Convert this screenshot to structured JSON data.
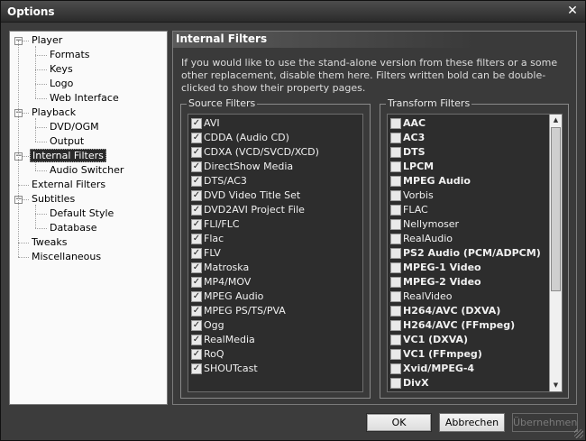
{
  "window": {
    "title": "Options",
    "close_glyph": "✕"
  },
  "tree": {
    "items": [
      {
        "label": "Player",
        "expander": "−"
      },
      {
        "label": "Formats"
      },
      {
        "label": "Keys"
      },
      {
        "label": "Logo"
      },
      {
        "label": "Web Interface"
      },
      {
        "label": "Playback",
        "expander": "−"
      },
      {
        "label": "DVD/OGM"
      },
      {
        "label": "Output"
      },
      {
        "label": "Internal Filters",
        "expander": "−",
        "selected": true
      },
      {
        "label": "Audio Switcher"
      },
      {
        "label": "External Filters"
      },
      {
        "label": "Subtitles",
        "expander": "−"
      },
      {
        "label": "Default Style"
      },
      {
        "label": "Database"
      },
      {
        "label": "Tweaks"
      },
      {
        "label": "Miscellaneous"
      }
    ]
  },
  "panel": {
    "header": "Internal Filters",
    "description": "If you would like to use the stand-alone version from these filters or a some other replacement, disable them here. Filters written bold can be double-clicked to show their property pages."
  },
  "source_filters": {
    "title": "Source Filters",
    "check_glyph": "✓",
    "items": [
      "AVI",
      "CDDA (Audio CD)",
      "CDXA (VCD/SVCD/XCD)",
      "DirectShow Media",
      "DTS/AC3",
      "DVD Video Title Set",
      "DVD2AVI Project File",
      "FLI/FLC",
      "Flac",
      "FLV",
      "Matroska",
      "MP4/MOV",
      "MPEG Audio",
      "MPEG PS/TS/PVA",
      "Ogg",
      "RealMedia",
      "RoQ",
      "SHOUTcast"
    ]
  },
  "transform_filters": {
    "title": "Transform Filters",
    "items": [
      {
        "label": "AAC",
        "bold": true
      },
      {
        "label": "AC3",
        "bold": true
      },
      {
        "label": "DTS",
        "bold": true
      },
      {
        "label": "LPCM",
        "bold": true
      },
      {
        "label": "MPEG Audio",
        "bold": true
      },
      {
        "label": "Vorbis",
        "bold": false
      },
      {
        "label": "FLAC",
        "bold": false
      },
      {
        "label": "Nellymoser",
        "bold": false
      },
      {
        "label": "RealAudio",
        "bold": false
      },
      {
        "label": "PS2 Audio (PCM/ADPCM)",
        "bold": true
      },
      {
        "label": "MPEG-1 Video",
        "bold": true
      },
      {
        "label": "MPEG-2 Video",
        "bold": true
      },
      {
        "label": "RealVideo",
        "bold": false
      },
      {
        "label": "H264/AVC (DXVA)",
        "bold": true
      },
      {
        "label": "H264/AVC (FFmpeg)",
        "bold": true
      },
      {
        "label": "VC1 (DXVA)",
        "bold": true
      },
      {
        "label": "VC1 (FFmpeg)",
        "bold": true
      },
      {
        "label": "Xvid/MPEG-4",
        "bold": true
      },
      {
        "label": "DivX",
        "bold": true
      }
    ],
    "scroll_up_glyph": "▲",
    "scroll_down_glyph": "▼"
  },
  "buttons": {
    "ok": "OK",
    "cancel": "Abbrechen",
    "apply": "Übernehmen"
  },
  "colors": {
    "panel_bg": "#3a3a3a",
    "tree_bg": "#fafafa",
    "selected_bg": "#2a2a2a"
  }
}
